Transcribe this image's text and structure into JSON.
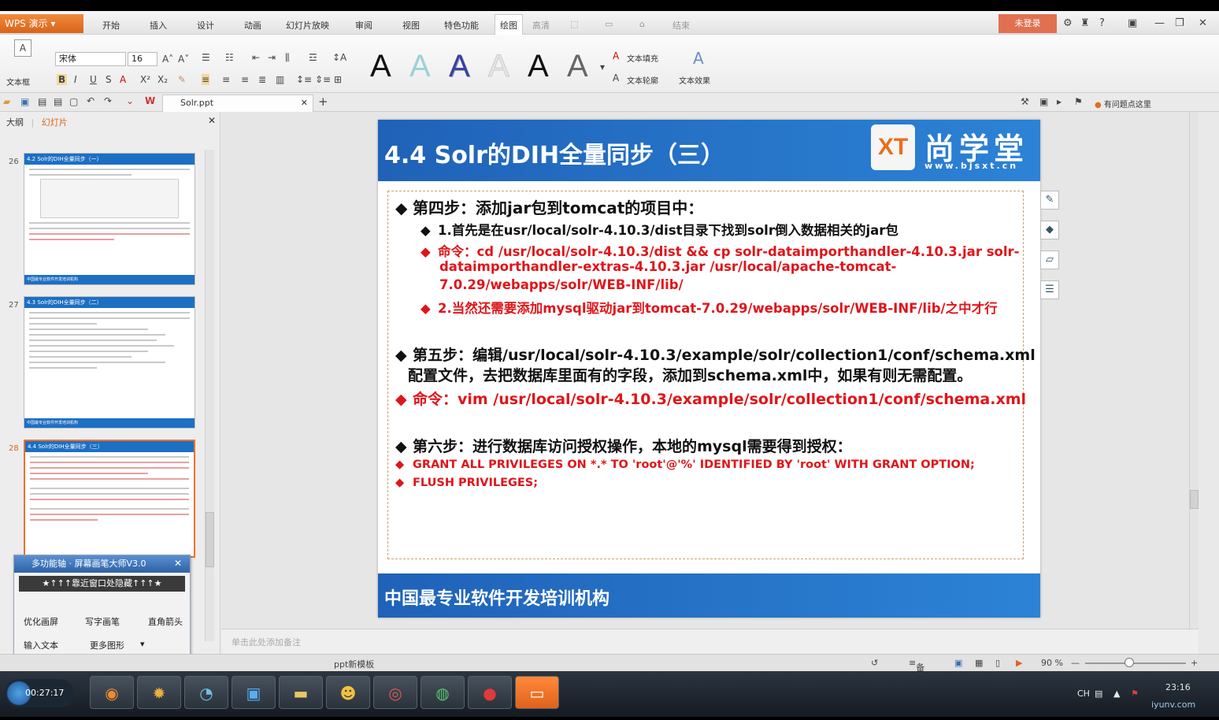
{
  "app": {
    "name": "WPS 演示",
    "login": "未登录"
  },
  "menu": [
    "开始",
    "插入",
    "设计",
    "动画",
    "幻灯片放映",
    "审阅",
    "视图",
    "特色功能",
    "绘图"
  ],
  "menu_extra": [
    "高清",
    "结束"
  ],
  "window_controls": [
    "?",
    "—",
    "❐",
    "✕"
  ],
  "ribbon": {
    "textbox_label": "文本框",
    "font_name": "宋体",
    "font_size": "16",
    "style_letters": [
      "A",
      "A",
      "A",
      "A",
      "A",
      "A"
    ],
    "text_fill": "文本填充",
    "text_outline": "文本轮廓",
    "text_effect": "文本效果"
  },
  "qat": {
    "doc_tab": "Solr.ppt",
    "add": "+",
    "help": "有问题点这里"
  },
  "left_panel": {
    "tabs": [
      "大纲",
      "幻灯片"
    ],
    "thumbnails": [
      {
        "num": "26",
        "title": "4.2 Solr的DIH全量同步（一）",
        "footer": "中国最专业软件开发培训机构"
      },
      {
        "num": "27",
        "title": "4.3 Solr的DIH全量同步（二）",
        "footer": "中国最专业软件开发培训机构"
      },
      {
        "num": "28",
        "title": "4.4 Solr的DIH全量同步（三）",
        "footer": "中国最专业软件开发培训机构"
      }
    ]
  },
  "pen_tool": {
    "title": "多功能轴 · 屏幕画笔大师V3.0",
    "bar": "★↑↑↑靠近窗口处隐藏↑↑↑★",
    "buttons": [
      "优化画屏",
      "写字画笔",
      "直角箭头",
      "输入文本",
      "更多图形"
    ]
  },
  "slide": {
    "title": "4.4 Solr的DIH全量同步（三）",
    "brand": "尚学堂",
    "brand_url": "www.bjsxt.cn",
    "logo": "XT",
    "footer": "中国最专业软件开发培训机构",
    "lines": [
      "第四步：添加jar包到tomcat的项目中：",
      "1.首先是在usr/local/solr-4.10.3/dist目录下找到solr倒入数据相关的jar包",
      "命令：cd /usr/local/solr-4.10.3/dist && cp solr-dataimporthandler-4.10.3.jar solr-",
      "dataimporthandler-extras-4.10.3.jar /usr/local/apache-tomcat-",
      "7.0.29/webapps/solr/WEB-INF/lib/",
      "2.当然还需要添加mysql驱动jar到tomcat-7.0.29/webapps/solr/WEB-INF/lib/之中才行",
      "第五步：编辑/usr/local/solr-4.10.3/example/solr/collection1/conf/schema.xml",
      "配置文件，去把数据库里面有的字段，添加到schema.xml中，如果有则无需配置。",
      "命令：vim /usr/local/solr-4.10.3/example/solr/collection1/conf/schema.xml",
      "第六步：进行数据库访问授权操作，本地的mysql需要得到授权：",
      "GRANT ALL PRIVILEGES ON *.* TO 'root'@'%' IDENTIFIED BY 'root' WITH GRANT OPTION;",
      "FLUSH PRIVILEGES;"
    ]
  },
  "notes_placeholder": "单击此处添加备注",
  "status": {
    "template": "ppt新模板",
    "notes": "备注",
    "zoom": "90 %"
  },
  "taskbar": {
    "clock_timer": "00:27:17",
    "time": "23:16",
    "lang": "CH"
  },
  "watermark": "iyunv.com",
  "colors": {
    "accent_orange": "#e0621d",
    "slide_blue": "#1f62b8",
    "slide_red": "#e0151a"
  }
}
